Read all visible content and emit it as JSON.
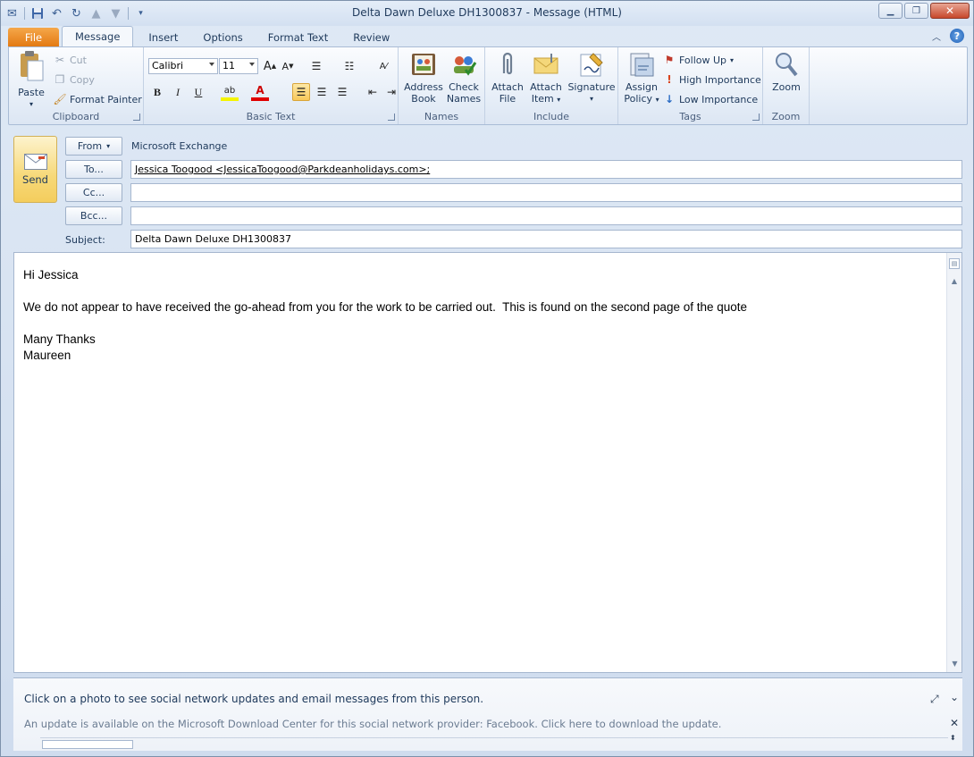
{
  "window": {
    "title": "Delta Dawn Deluxe DH1300837  -  Message (HTML)",
    "minimize": "▁",
    "maximize": "❐",
    "close": "✕"
  },
  "tabs": [
    {
      "label": "File"
    },
    {
      "label": "Message"
    },
    {
      "label": "Insert"
    },
    {
      "label": "Options"
    },
    {
      "label": "Format Text"
    },
    {
      "label": "Review"
    }
  ],
  "ribbon": {
    "clipboard": {
      "label": "Clipboard",
      "paste": "Paste",
      "cut": "Cut",
      "copy": "Copy",
      "format_painter": "Format Painter"
    },
    "basic_text": {
      "label": "Basic Text",
      "font": "Calibri",
      "size": "11",
      "bold": "B",
      "italic": "I",
      "underline": "U"
    },
    "names": {
      "label": "Names",
      "address_book_1": "Address",
      "address_book_2": "Book",
      "check_names_1": "Check",
      "check_names_2": "Names"
    },
    "include": {
      "label": "Include",
      "attach_file_1": "Attach",
      "attach_file_2": "File",
      "attach_item_1": "Attach",
      "attach_item_2": "Item",
      "signature": "Signature"
    },
    "tags": {
      "label": "Tags",
      "assign_policy_1": "Assign",
      "assign_policy_2": "Policy",
      "follow_up": "Follow Up",
      "high_importance": "High Importance",
      "low_importance": "Low Importance"
    },
    "zoom": {
      "label": "Zoom",
      "zoom": "Zoom"
    }
  },
  "header": {
    "send": "Send",
    "from_label": "From",
    "from_value": "Microsoft Exchange",
    "to_label": "To...",
    "to_value": "Jessica Toogood <JessicaToogood@Parkdeanholidays.com>;",
    "cc_label": "Cc...",
    "cc_value": "",
    "bcc_label": "Bcc...",
    "bcc_value": "",
    "subject_label": "Subject:",
    "subject_value": "Delta Dawn Deluxe DH1300837"
  },
  "body": {
    "greeting": "Hi Jessica",
    "paragraph": "We do not appear to have received the go-ahead from you for the work to be carried out.  This is found on the second page of the quote",
    "signoff": "Many Thanks",
    "name": "Maureen"
  },
  "social": {
    "message": "Click on a photo to see social network updates and email messages from this person.",
    "update": "An update is available on the Microsoft Download Center for this social network provider: Facebook. Click here to download the update."
  },
  "colors": {
    "file_tab": "#e37a13",
    "send_button": "#f7d979",
    "follow_up_flag": "#c0392b",
    "high_importance": "#d9441d",
    "low_importance": "#2b6cc4"
  }
}
